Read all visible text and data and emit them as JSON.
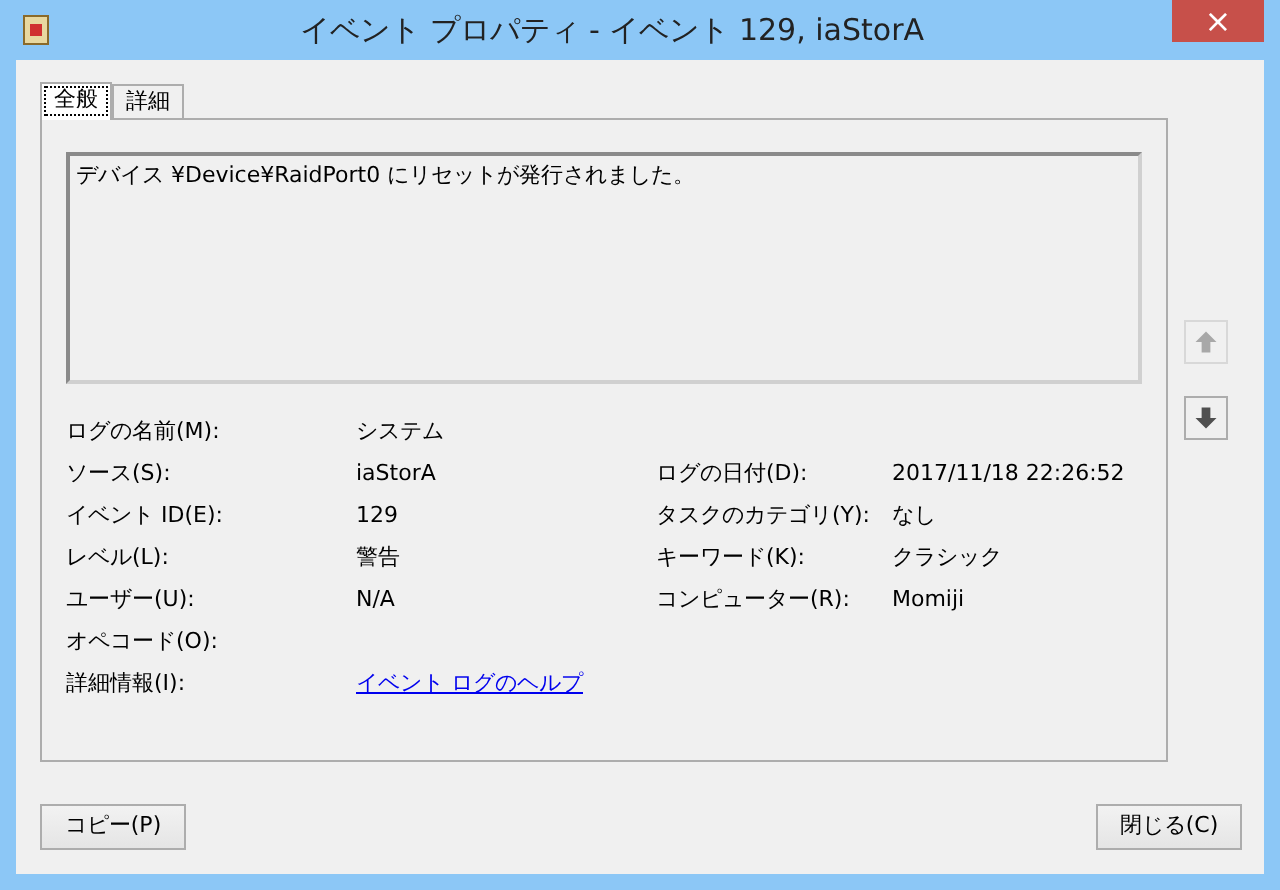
{
  "window": {
    "title": "イベント プロパティ - イベント 129, iaStorA",
    "close": "×"
  },
  "tabs": [
    {
      "label": "全般",
      "selected": true
    },
    {
      "label": "詳細",
      "selected": false
    }
  ],
  "message": "デバイス ¥Device¥RaidPort0 にリセットが発行されました。",
  "rows": [
    {
      "left": {
        "label": "ログの名前(M):",
        "value": "システム"
      }
    },
    {
      "left": {
        "label": "ソース(S):",
        "value": "iaStorA"
      },
      "right": {
        "label": "ログの日付(D):",
        "value": "2017/11/18 22:26:52"
      }
    },
    {
      "left": {
        "label": "イベント ID(E):",
        "value": "129"
      },
      "right": {
        "label": "タスクのカテゴリ(Y):",
        "value": "なし"
      }
    },
    {
      "left": {
        "label": "レベル(L):",
        "value": "警告"
      },
      "right": {
        "label": "キーワード(K):",
        "value": "クラシック"
      }
    },
    {
      "left": {
        "label": "ユーザー(U):",
        "value": "N/A"
      },
      "right": {
        "label": "コンピューター(R):",
        "value": "Momiji"
      }
    },
    {
      "left": {
        "label": "オペコード(O):"
      }
    },
    {
      "left": {
        "label": "詳細情報(I):",
        "value": "イベント ログのヘルプ",
        "kind": "link"
      }
    }
  ],
  "nav": [
    {
      "kind": "up",
      "disabled": true
    },
    {
      "kind": "down",
      "disabled": false
    }
  ],
  "buttons": [
    {
      "label": "コピー(P)"
    },
    {
      "label": "閉じる(C)"
    }
  ]
}
